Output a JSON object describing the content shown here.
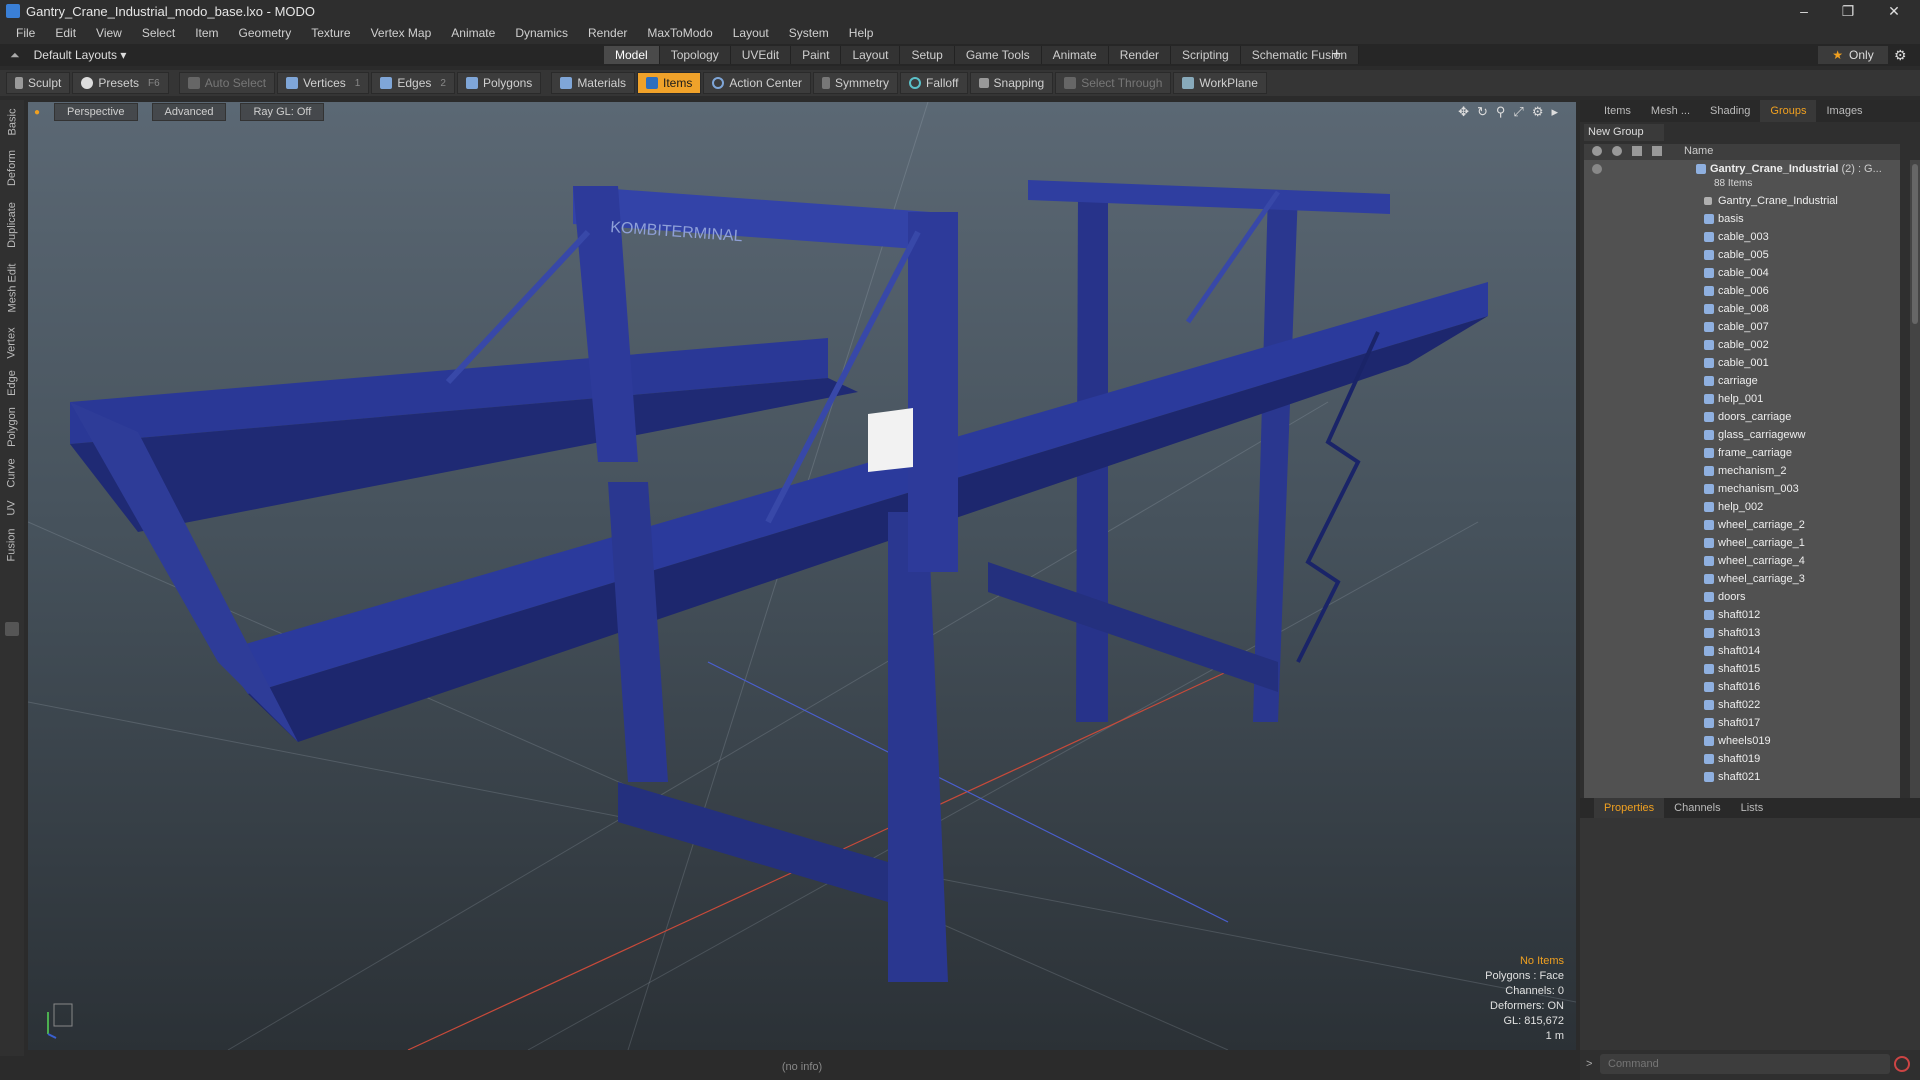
{
  "window": {
    "title": "Gantry_Crane_Industrial_modo_base.lxo - MODO",
    "controls": [
      "–",
      "❐",
      "✕"
    ]
  },
  "menu": [
    "File",
    "Edit",
    "View",
    "Select",
    "Item",
    "Geometry",
    "Texture",
    "Vertex Map",
    "Animate",
    "Dynamics",
    "Render",
    "MaxToModo",
    "Layout",
    "System",
    "Help"
  ],
  "layout": {
    "selector": "Default Layouts ▾",
    "tabs": [
      "Model",
      "Topology",
      "UVEdit",
      "Paint",
      "Layout",
      "Setup",
      "Game Tools",
      "Animate",
      "Render",
      "Scripting",
      "Schematic Fusion"
    ],
    "active_tab": "Model",
    "plus": "+",
    "only": "Only"
  },
  "toolbar": {
    "sculpt": "Sculpt",
    "presets": "Presets",
    "presets_key": "F6",
    "auto_select": "Auto Select",
    "vertices": "Vertices",
    "vertices_key": "1",
    "edges": "Edges",
    "edges_key": "2",
    "polygons": "Polygons",
    "materials": "Materials",
    "items": "Items",
    "action_center": "Action Center",
    "symmetry": "Symmetry",
    "falloff": "Falloff",
    "snapping": "Snapping",
    "select_through": "Select Through",
    "workplane": "WorkPlane"
  },
  "left_tabs": [
    "Basic",
    "Deform",
    "Duplicate",
    "Mesh Edit",
    "Vertex",
    "Edge",
    "Polygon",
    "Curve",
    "UV",
    "Fusion"
  ],
  "viewport": {
    "perspective": "Perspective",
    "advanced": "Advanced",
    "raygl": "Ray GL: Off",
    "info": {
      "no_items": "No Items",
      "polygons": "Polygons : Face",
      "channels": "Channels: 0",
      "deformers": "Deformers: ON",
      "gl": "GL: 815,672",
      "scale": "1 m"
    },
    "sign_text": "KOMBITERMINAL"
  },
  "status": "(no info)",
  "panel": {
    "tabs": [
      "Items",
      "Mesh ...",
      "Shading",
      "Groups",
      "Images"
    ],
    "active_tab": "Groups",
    "new_group": "New Group",
    "column_name": "Name",
    "root": {
      "name": "Gantry_Crane_Industrial",
      "suffix": "(2) : G...",
      "count": "88 Items"
    },
    "items": [
      "Gantry_Crane_Industrial",
      "basis",
      "cable_003",
      "cable_005",
      "cable_004",
      "cable_006",
      "cable_008",
      "cable_007",
      "cable_002",
      "cable_001",
      "carriage",
      "help_001",
      "doors_carriage",
      "glass_carriageww",
      "frame_carriage",
      "mechanism_2",
      "mechanism_003",
      "help_002",
      "wheel_carriage_2",
      "wheel_carriage_1",
      "wheel_carriage_4",
      "wheel_carriage_3",
      "doors",
      "shaft012",
      "shaft013",
      "shaft014",
      "shaft015",
      "shaft016",
      "shaft022",
      "shaft017",
      "wheels019",
      "shaft019",
      "shaft021"
    ],
    "bottom_tabs": [
      "Properties",
      "Channels",
      "Lists"
    ],
    "bottom_active": "Properties",
    "command_placeholder": "Command"
  }
}
